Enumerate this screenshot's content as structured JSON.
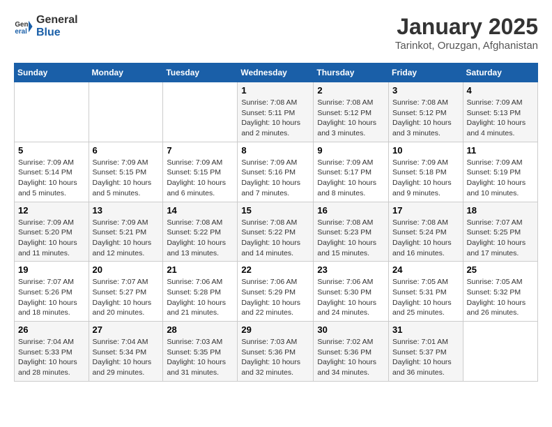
{
  "header": {
    "logo_general": "General",
    "logo_blue": "Blue",
    "title": "January 2025",
    "subtitle": "Tarinkot, Oruzgan, Afghanistan"
  },
  "days_of_week": [
    "Sunday",
    "Monday",
    "Tuesday",
    "Wednesday",
    "Thursday",
    "Friday",
    "Saturday"
  ],
  "weeks": [
    [
      {
        "day": "",
        "info": ""
      },
      {
        "day": "",
        "info": ""
      },
      {
        "day": "",
        "info": ""
      },
      {
        "day": "1",
        "info": "Sunrise: 7:08 AM\nSunset: 5:11 PM\nDaylight: 10 hours\nand 2 minutes."
      },
      {
        "day": "2",
        "info": "Sunrise: 7:08 AM\nSunset: 5:12 PM\nDaylight: 10 hours\nand 3 minutes."
      },
      {
        "day": "3",
        "info": "Sunrise: 7:08 AM\nSunset: 5:12 PM\nDaylight: 10 hours\nand 3 minutes."
      },
      {
        "day": "4",
        "info": "Sunrise: 7:09 AM\nSunset: 5:13 PM\nDaylight: 10 hours\nand 4 minutes."
      }
    ],
    [
      {
        "day": "5",
        "info": "Sunrise: 7:09 AM\nSunset: 5:14 PM\nDaylight: 10 hours\nand 5 minutes."
      },
      {
        "day": "6",
        "info": "Sunrise: 7:09 AM\nSunset: 5:15 PM\nDaylight: 10 hours\nand 5 minutes."
      },
      {
        "day": "7",
        "info": "Sunrise: 7:09 AM\nSunset: 5:15 PM\nDaylight: 10 hours\nand 6 minutes."
      },
      {
        "day": "8",
        "info": "Sunrise: 7:09 AM\nSunset: 5:16 PM\nDaylight: 10 hours\nand 7 minutes."
      },
      {
        "day": "9",
        "info": "Sunrise: 7:09 AM\nSunset: 5:17 PM\nDaylight: 10 hours\nand 8 minutes."
      },
      {
        "day": "10",
        "info": "Sunrise: 7:09 AM\nSunset: 5:18 PM\nDaylight: 10 hours\nand 9 minutes."
      },
      {
        "day": "11",
        "info": "Sunrise: 7:09 AM\nSunset: 5:19 PM\nDaylight: 10 hours\nand 10 minutes."
      }
    ],
    [
      {
        "day": "12",
        "info": "Sunrise: 7:09 AM\nSunset: 5:20 PM\nDaylight: 10 hours\nand 11 minutes."
      },
      {
        "day": "13",
        "info": "Sunrise: 7:09 AM\nSunset: 5:21 PM\nDaylight: 10 hours\nand 12 minutes."
      },
      {
        "day": "14",
        "info": "Sunrise: 7:08 AM\nSunset: 5:22 PM\nDaylight: 10 hours\nand 13 minutes."
      },
      {
        "day": "15",
        "info": "Sunrise: 7:08 AM\nSunset: 5:22 PM\nDaylight: 10 hours\nand 14 minutes."
      },
      {
        "day": "16",
        "info": "Sunrise: 7:08 AM\nSunset: 5:23 PM\nDaylight: 10 hours\nand 15 minutes."
      },
      {
        "day": "17",
        "info": "Sunrise: 7:08 AM\nSunset: 5:24 PM\nDaylight: 10 hours\nand 16 minutes."
      },
      {
        "day": "18",
        "info": "Sunrise: 7:07 AM\nSunset: 5:25 PM\nDaylight: 10 hours\nand 17 minutes."
      }
    ],
    [
      {
        "day": "19",
        "info": "Sunrise: 7:07 AM\nSunset: 5:26 PM\nDaylight: 10 hours\nand 18 minutes."
      },
      {
        "day": "20",
        "info": "Sunrise: 7:07 AM\nSunset: 5:27 PM\nDaylight: 10 hours\nand 20 minutes."
      },
      {
        "day": "21",
        "info": "Sunrise: 7:06 AM\nSunset: 5:28 PM\nDaylight: 10 hours\nand 21 minutes."
      },
      {
        "day": "22",
        "info": "Sunrise: 7:06 AM\nSunset: 5:29 PM\nDaylight: 10 hours\nand 22 minutes."
      },
      {
        "day": "23",
        "info": "Sunrise: 7:06 AM\nSunset: 5:30 PM\nDaylight: 10 hours\nand 24 minutes."
      },
      {
        "day": "24",
        "info": "Sunrise: 7:05 AM\nSunset: 5:31 PM\nDaylight: 10 hours\nand 25 minutes."
      },
      {
        "day": "25",
        "info": "Sunrise: 7:05 AM\nSunset: 5:32 PM\nDaylight: 10 hours\nand 26 minutes."
      }
    ],
    [
      {
        "day": "26",
        "info": "Sunrise: 7:04 AM\nSunset: 5:33 PM\nDaylight: 10 hours\nand 28 minutes."
      },
      {
        "day": "27",
        "info": "Sunrise: 7:04 AM\nSunset: 5:34 PM\nDaylight: 10 hours\nand 29 minutes."
      },
      {
        "day": "28",
        "info": "Sunrise: 7:03 AM\nSunset: 5:35 PM\nDaylight: 10 hours\nand 31 minutes."
      },
      {
        "day": "29",
        "info": "Sunrise: 7:03 AM\nSunset: 5:36 PM\nDaylight: 10 hours\nand 32 minutes."
      },
      {
        "day": "30",
        "info": "Sunrise: 7:02 AM\nSunset: 5:36 PM\nDaylight: 10 hours\nand 34 minutes."
      },
      {
        "day": "31",
        "info": "Sunrise: 7:01 AM\nSunset: 5:37 PM\nDaylight: 10 hours\nand 36 minutes."
      },
      {
        "day": "",
        "info": ""
      }
    ]
  ]
}
